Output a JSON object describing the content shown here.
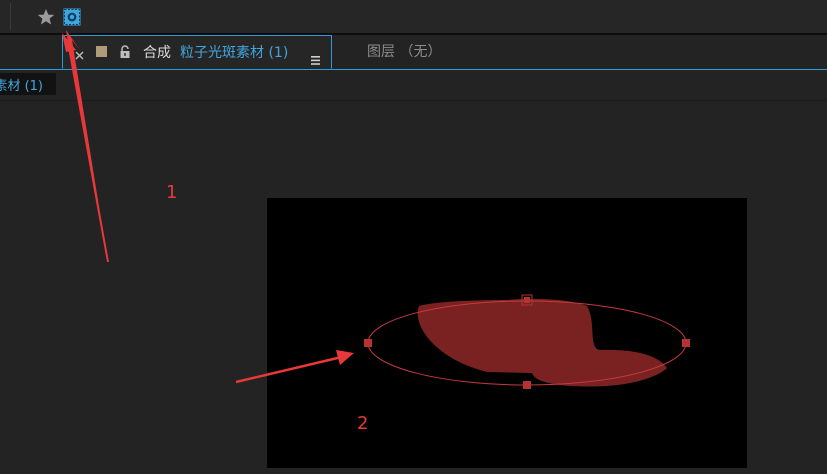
{
  "toolbar": {
    "icons": [
      "star-icon",
      "mask-tool-icon"
    ],
    "active_tool_color": "#3fa6e0"
  },
  "tabs": {
    "active": {
      "prefix": "合成",
      "name": "粒子光斑素材 (1)",
      "swatch_color": "#b09b7a",
      "icons": [
        "close-icon",
        "lock-icon",
        "menu-icon"
      ]
    },
    "layer_tab_label": "图层 （无）"
  },
  "breadcrumb": {
    "label": "素材 (1)"
  },
  "viewer": {
    "canvas_color": "#000000",
    "shape_color": "#7a2222",
    "mask_color": "#c43b3b"
  },
  "annotations": {
    "label_1": "1",
    "label_2": "2",
    "arrow_color": "#e8383a"
  }
}
